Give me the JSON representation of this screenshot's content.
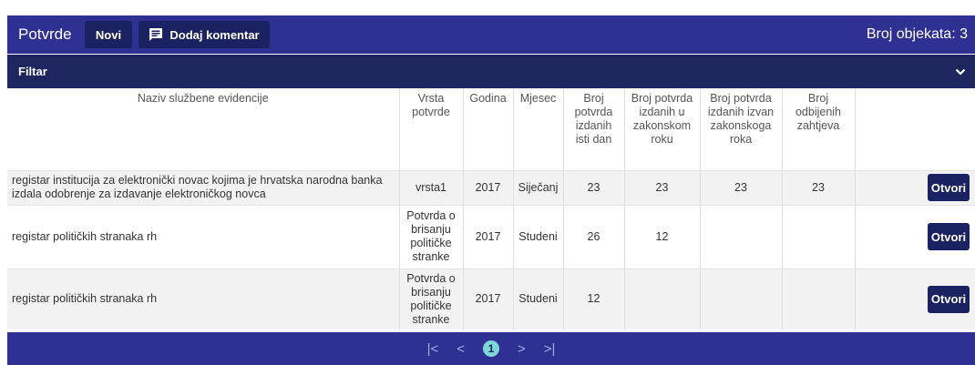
{
  "header": {
    "title": "Potvrde",
    "new_label": "Novi",
    "comment_label": "Dodaj komentar",
    "count_text": "Broj objekata: 3"
  },
  "filter": {
    "label": "Filtar"
  },
  "table": {
    "columns": [
      "Naziv službene evidencije",
      "Vrsta potvrde",
      "Godina",
      "Mjesec",
      "Broj potvrda izdanih isti dan",
      "Broj potvrda izdanih u zakonskom roku",
      "Broj potvrda izdanih izvan zakonskoga roka",
      "Broj odbijenih zahtjeva",
      ""
    ],
    "rows": [
      {
        "naziv": "registar institucija za elektronički novac kojima je hrvatska narodna banka izdala odobrenje za izdavanje elektroničkog novca",
        "vrsta": "vrsta1",
        "godina": "2017",
        "mjesec": "Siječanj",
        "isti_dan": "23",
        "u_roku": "23",
        "izvan_roka": "23",
        "odbijeni": "23",
        "action": "Otvori"
      },
      {
        "naziv": "registar političkih stranaka rh",
        "vrsta": "Potvrda o brisanju političke stranke",
        "godina": "2017",
        "mjesec": "Studeni",
        "isti_dan": "26",
        "u_roku": "12",
        "izvan_roka": "",
        "odbijeni": "",
        "action": "Otvori"
      },
      {
        "naziv": "registar političkih stranaka rh",
        "vrsta": "Potvrda o brisanju političke stranke",
        "godina": "2017",
        "mjesec": "Studeni",
        "isti_dan": "12",
        "u_roku": "",
        "izvan_roka": "",
        "odbijeni": "",
        "action": "Otvori"
      }
    ]
  },
  "pagination": {
    "first": "|<",
    "prev": "<",
    "current": "1",
    "next": ">",
    "last": ">|"
  },
  "colors": {
    "header_bg": "#2e3192",
    "filter_bg": "#1e2660",
    "button_bg": "#1b2261",
    "active_page": "#7fd6d8"
  }
}
